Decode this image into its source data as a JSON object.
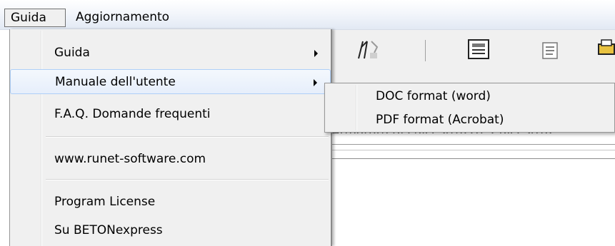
{
  "menubar": {
    "items": [
      {
        "label": "Guida"
      },
      {
        "label": "Aggiornamento"
      }
    ]
  },
  "menu": {
    "items": [
      {
        "label": "Guida"
      },
      {
        "label": "Manuale dell'utente"
      },
      {
        "label": "F.A.Q. Domande  frequenti"
      },
      {
        "label": "www.runet-software.com"
      },
      {
        "label": "Program License"
      },
      {
        "label": "Su BETONexpress"
      }
    ]
  },
  "submenu": {
    "items": [
      {
        "label": "DOC format (word)"
      },
      {
        "label": "PDF format (Acrobat)"
      }
    ]
  },
  "background": {
    "partial_text": "Armatura di calcestruzzo, Calcestruz"
  },
  "colors": {
    "highlight_border": "#aecff7",
    "menu_bg": "#f0f0f0",
    "menubar_bg": "#e2e9f4"
  }
}
